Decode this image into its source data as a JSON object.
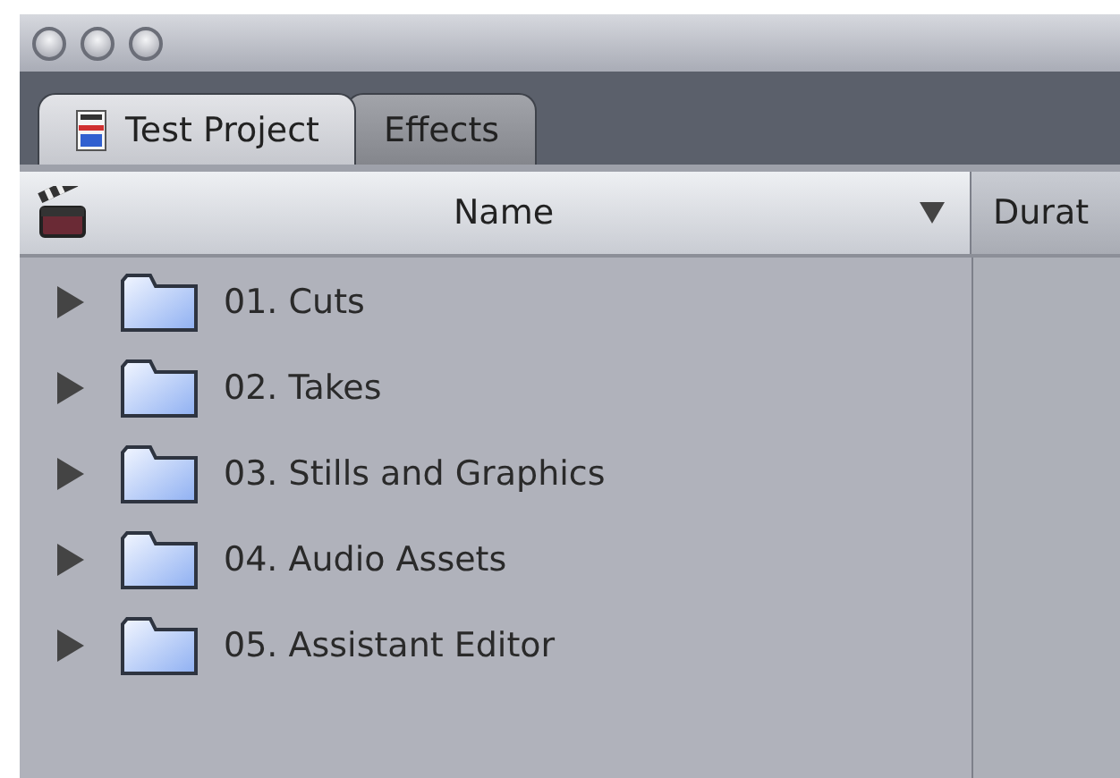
{
  "tabs": [
    {
      "label": "Test Project",
      "selected": true
    },
    {
      "label": "Effects",
      "selected": false
    }
  ],
  "table": {
    "columns": [
      "Name",
      "Durat"
    ],
    "rows": [
      {
        "name": "01. Cuts",
        "expanded": false
      },
      {
        "name": "02. Takes",
        "expanded": false
      },
      {
        "name": "03. Stills and Graphics",
        "expanded": false
      },
      {
        "name": "04. Audio Assets",
        "expanded": false
      },
      {
        "name": "05. Assistant Editor",
        "expanded": false
      }
    ]
  }
}
